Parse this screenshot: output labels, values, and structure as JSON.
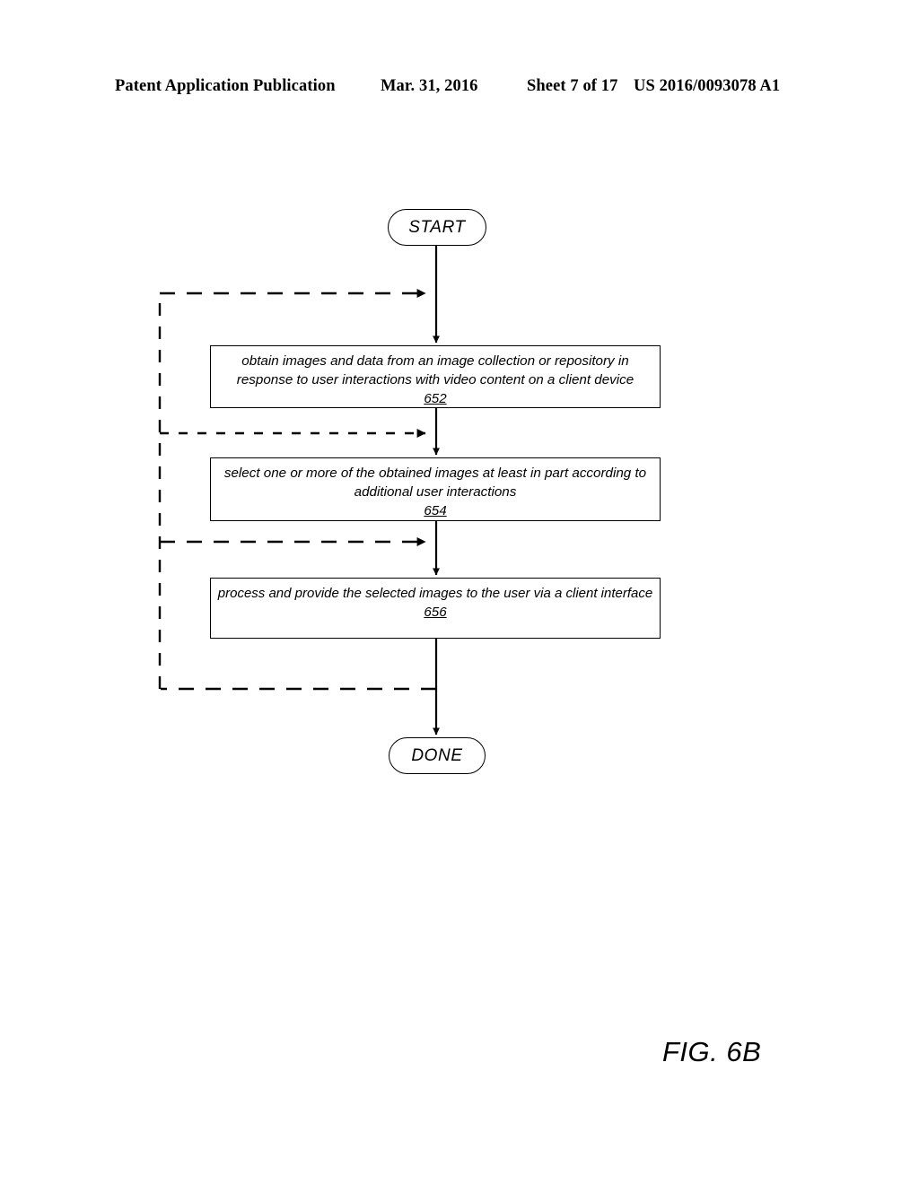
{
  "header": {
    "publication": "Patent Application Publication",
    "date": "Mar. 31, 2016",
    "sheet": "Sheet 7 of 17",
    "patent_number": "US 2016/0093078 A1"
  },
  "figure": {
    "caption": "FIG. 6B",
    "nodes": {
      "start": "START",
      "done": "DONE"
    },
    "steps": [
      {
        "id": "652",
        "text": "obtain images and data from an image collection or repository in\nresponse to user interactions with video content on a client device",
        "ref": "652"
      },
      {
        "id": "654",
        "text": "select one or more of the obtained images at least in part according to\nadditional user interactions",
        "ref": "654"
      },
      {
        "id": "656",
        "text": "process and provide the selected images to the user via a client interface",
        "ref": "656"
      }
    ],
    "colors": {
      "stroke": "#000000",
      "background": "#ffffff"
    }
  }
}
